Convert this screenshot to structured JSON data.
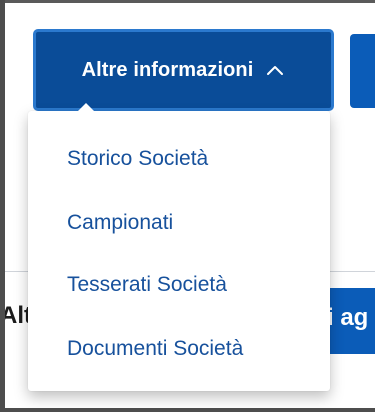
{
  "toggle": {
    "label": "Altre informazioni",
    "icon": "chevron-up-icon"
  },
  "menu": {
    "items": [
      {
        "label": "Storico Società"
      },
      {
        "label": "Campionati"
      },
      {
        "label": "Tesserati Società"
      },
      {
        "label": "Documenti Società"
      }
    ]
  },
  "background": {
    "left_fragment": "Alt",
    "right_fragment": "i ag"
  },
  "colors": {
    "toggle_background": "#0a4c98",
    "toggle_border": "#2b79ce",
    "menu_link": "#17519c",
    "secondary_blue": "#0b5cb8"
  }
}
